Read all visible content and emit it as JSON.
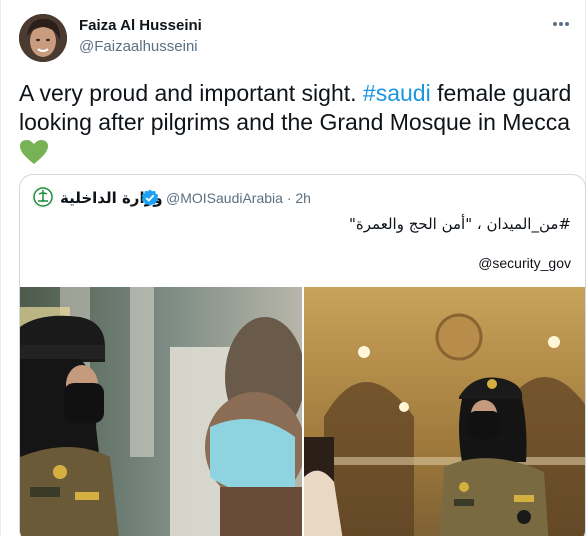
{
  "tweet": {
    "author_name": "Faiza Al Husseini",
    "author_handle": "@Faizaalhusseini",
    "text_before": "A very proud and important sight. ",
    "hashtag": "#saudi",
    "text_after": " female guard looking after pilgrims and the Grand Mosque in Mecca",
    "emoji": "green-heart-icon"
  },
  "quoted_tweet": {
    "author_name": "وزارة الداخلية",
    "handle": "@MOISaudiArabia",
    "separator": "·",
    "time": "2h",
    "arabic_text": "#من_الميدان ، \"أمن الحج والعمرة\"",
    "mention": "@security_gov",
    "images": [
      "female-guard-photo-left",
      "female-guard-photo-right"
    ]
  },
  "colors": {
    "accent": "#1b95e0",
    "secondary_text": "#5b7083",
    "border": "#cfd9de",
    "heart": "#77b255",
    "verified": "#1da1f2"
  }
}
